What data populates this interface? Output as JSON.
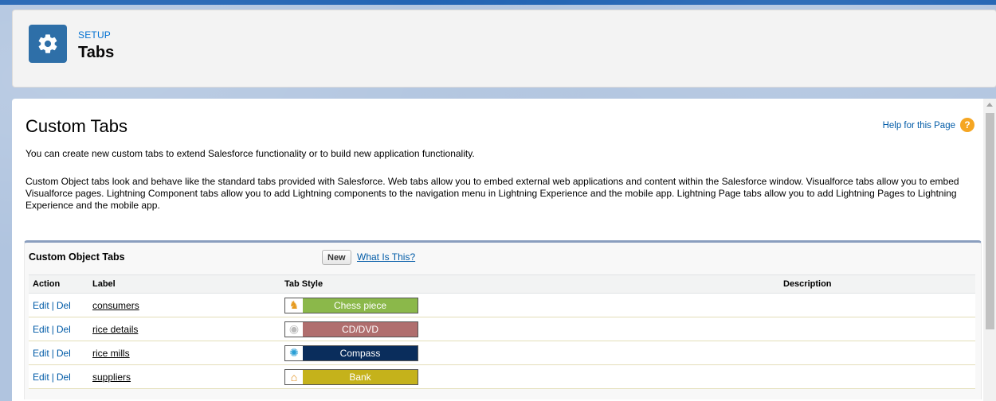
{
  "header": {
    "setup_label": "SETUP",
    "title": "Tabs"
  },
  "page": {
    "title": "Custom Tabs",
    "help_link": "Help for this Page",
    "intro": "You can create new custom tabs to extend Salesforce functionality or to build new application functionality.",
    "description": "Custom Object tabs look and behave like the standard tabs provided with Salesforce. Web tabs allow you to embed external web applications and content within the Salesforce window. Visualforce tabs allow you to embed Visualforce pages. Lightning Component tabs allow you to add Lightning components to the navigation menu in Lightning Experience and the mobile app. Lightning Page tabs allow you to add Lightning Pages to Lightning Experience and the mobile app."
  },
  "custom_object_tabs": {
    "title": "Custom Object Tabs",
    "new_button": "New",
    "what_link": "What Is This?",
    "columns": [
      "Action",
      "Label",
      "Tab Style",
      "Description"
    ],
    "edit_label": "Edit",
    "del_label": "Del",
    "separator": "|",
    "rows": [
      {
        "label": "consumers",
        "style": "Chess piece",
        "style_color": "#8bb84a",
        "icon": "chess-piece-icon",
        "description": ""
      },
      {
        "label": "rice details",
        "style": "CD/DVD",
        "style_color": "#b06e6e",
        "icon": "cd-dvd-icon",
        "description": ""
      },
      {
        "label": "rice mills",
        "style": "Compass",
        "style_color": "#0a2d5c",
        "icon": "compass-icon",
        "description": ""
      },
      {
        "label": "suppliers",
        "style": "Bank",
        "style_color": "#c5b21b",
        "icon": "bank-icon",
        "description": ""
      }
    ]
  },
  "colors": {
    "brand_blue": "#2e6fa8",
    "link": "#015ba7",
    "help_orange": "#f5a623"
  }
}
